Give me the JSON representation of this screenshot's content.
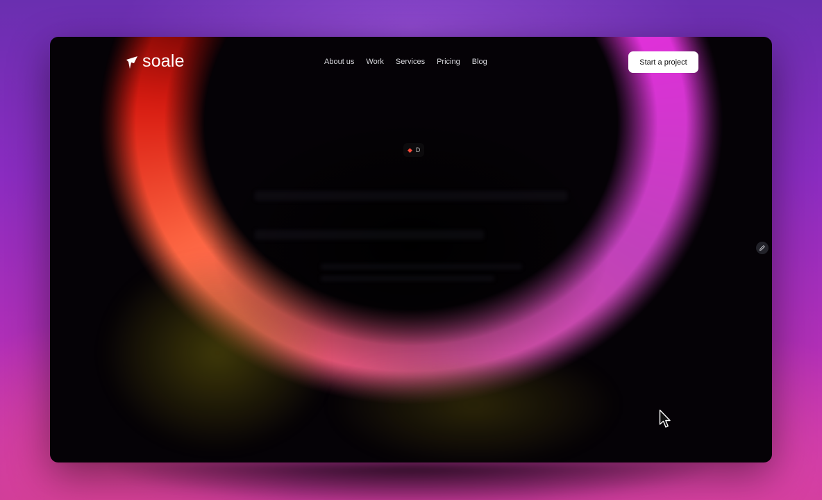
{
  "brand": {
    "name": "soale"
  },
  "nav": {
    "items": [
      {
        "label": "About us"
      },
      {
        "label": "Work"
      },
      {
        "label": "Services"
      },
      {
        "label": "Pricing"
      },
      {
        "label": "Blog"
      }
    ],
    "cta_label": "Start a project"
  },
  "hero": {
    "badge_icon": "diamond-icon",
    "badge_text": "D"
  },
  "icons": {
    "logo": "soale-logo-icon",
    "edit": "pencil-icon",
    "cursor": "cursor-icon"
  },
  "colors": {
    "background_top": "#6a2fb0",
    "background_bottom": "#c83a9a",
    "window": "#050206",
    "ring_magenta": "#ff14ff",
    "ring_orange": "#ff6a45",
    "badge_accent": "#ff4a3a",
    "cta_background": "#ffffff"
  }
}
